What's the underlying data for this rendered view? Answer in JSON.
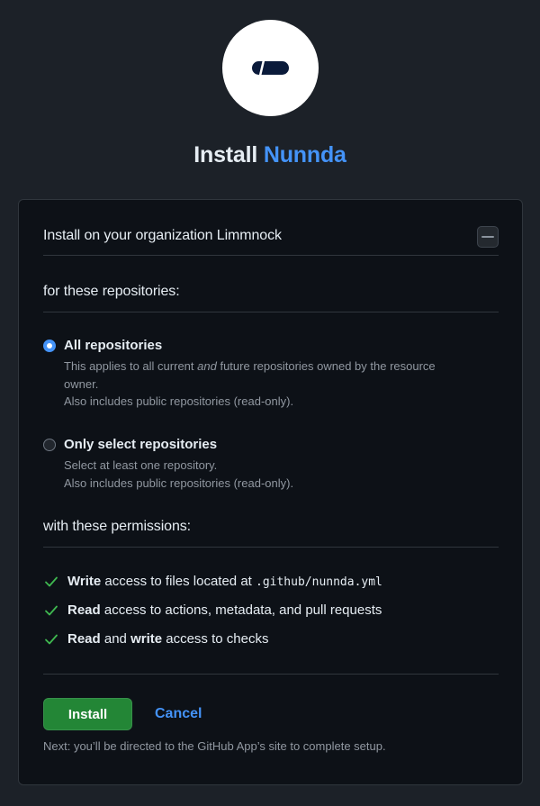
{
  "header": {
    "logo_icon": "nunnda-logo-icon",
    "title_prefix": "Install",
    "app_name": "Nunnda",
    "app_name_color": "#4493f8"
  },
  "org": {
    "label": "Install on your organization Limmnock",
    "avatar_icon": "organization-avatar"
  },
  "repositories": {
    "title": "for these repositories:",
    "options": [
      {
        "label": "All repositories",
        "selected": true,
        "desc_line1_a": "This applies to all current",
        "desc_line1_em": "and",
        "desc_line1_b": "future repositories owned by the resource",
        "desc_line2": "owner.",
        "desc_line3": "Also includes public repositories (read-only)."
      },
      {
        "label": "Only select repositories",
        "selected": false,
        "desc_line1": "Select at least one repository.",
        "desc_line2": "Also includes public repositories (read-only)."
      }
    ]
  },
  "permissions": {
    "title": "with these permissions:",
    "check_icon": "check-icon",
    "check_color": "#3fb950",
    "items": [
      {
        "strong": "Write",
        "text": "access to files located at",
        "code": ".github/nunnda.yml"
      },
      {
        "strong": "Read",
        "text": "access to actions, metadata, and pull requests"
      },
      {
        "strong": "Read",
        "text_mid": "and",
        "strong2": "write",
        "text": "access to checks"
      }
    ]
  },
  "actions": {
    "install_label": "Install",
    "install_color": "#238636",
    "cancel_label": "Cancel",
    "next_note": "Next: you’ll be directed to the GitHub App’s site to complete setup."
  }
}
